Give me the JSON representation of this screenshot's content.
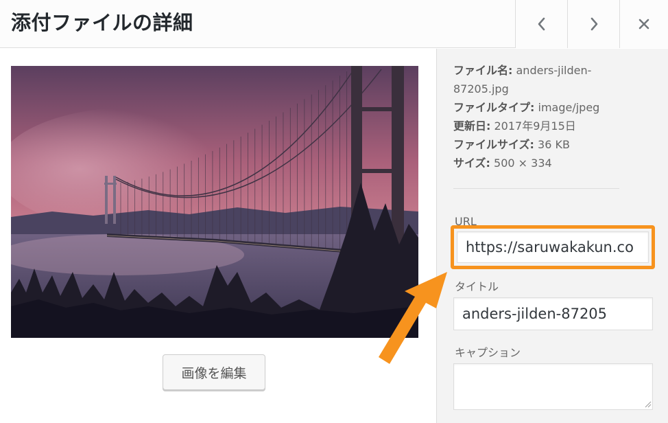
{
  "header": {
    "title": "添付ファイルの詳細",
    "prev_icon": "chevron-left-icon",
    "next_icon": "chevron-right-icon",
    "close_icon": "close-icon"
  },
  "attachment": {
    "filename_label": "ファイル名:",
    "filename_value": "anders-jilden-87205.jpg",
    "filename_line1": "anders-jilden-",
    "filename_line2": "87205.jpg",
    "filetype_label": "ファイルタイプ:",
    "filetype_value": "image/jpeg",
    "updated_label": "更新日:",
    "updated_value": "2017年9月15日",
    "filesize_label": "ファイルサイズ:",
    "filesize_value": "36 KB",
    "dimensions_label": "サイズ:",
    "dimensions_value": "500 × 334"
  },
  "preview": {
    "edit_button_label": "画像を編集"
  },
  "fields": {
    "url_label": "URL",
    "url_value": "https://saruwakakun.co",
    "title_label": "タイトル",
    "title_value": "anders-jilden-87205",
    "caption_label": "キャプション",
    "caption_value": ""
  },
  "colors": {
    "highlight": "#f7931e",
    "header_bg": "#fcfcfc",
    "sidebar_bg": "#f3f3f3"
  }
}
